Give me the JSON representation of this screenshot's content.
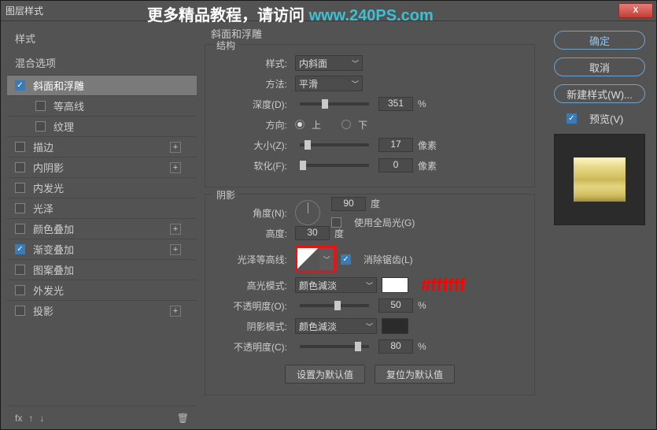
{
  "title": "图层样式",
  "banner": {
    "t1": "更多精品教程，请访问 ",
    "t2": "www.240PS.com"
  },
  "close_x": "X",
  "left": {
    "header": "样式",
    "blend": "混合选项",
    "items": [
      {
        "label": "斜面和浮雕",
        "checked": true,
        "selected": true,
        "plus": false
      },
      {
        "label": "等高线",
        "checked": false,
        "sub": true
      },
      {
        "label": "纹理",
        "checked": false,
        "sub": true
      },
      {
        "label": "描边",
        "checked": false,
        "plus": true
      },
      {
        "label": "内阴影",
        "checked": false,
        "plus": true
      },
      {
        "label": "内发光",
        "checked": false
      },
      {
        "label": "光泽",
        "checked": false
      },
      {
        "label": "颜色叠加",
        "checked": false,
        "plus": true
      },
      {
        "label": "渐变叠加",
        "checked": true,
        "plus": true
      },
      {
        "label": "图案叠加",
        "checked": false
      },
      {
        "label": "外发光",
        "checked": false
      },
      {
        "label": "投影",
        "checked": false,
        "plus": true
      }
    ],
    "footer_fx": "fx"
  },
  "middle": {
    "section": "斜面和浮雕",
    "struct_label": "结构",
    "style_lbl": "样式:",
    "style_val": "内斜面",
    "tech_lbl": "方法:",
    "tech_val": "平滑",
    "depth_lbl": "深度(D):",
    "depth_val": "351",
    "pct": "%",
    "dir_lbl": "方向:",
    "dir_up": "上",
    "dir_down": "下",
    "size_lbl": "大小(Z):",
    "size_val": "17",
    "px": "像素",
    "soften_lbl": "软化(F):",
    "soften_val": "0",
    "shade_label": "阴影",
    "angle_lbl": "角度(N):",
    "angle_val": "90",
    "deg": "度",
    "global_lbl": "使用全局光(G)",
    "alt_lbl": "高度:",
    "alt_val": "30",
    "contour_lbl": "光泽等高线:",
    "aa_lbl": "消除锯齿(L)",
    "hmode_lbl": "高光模式:",
    "hmode_val": "颜色減淡",
    "annot": "#ffffff",
    "hop_lbl": "不透明度(O):",
    "hop_val": "50",
    "smode_lbl": "阴影模式:",
    "smode_val": "颜色減淡",
    "sop_lbl": "不透明度(C):",
    "sop_val": "80",
    "reset_btn": "设置为默认值",
    "restore_btn": "复位为默认值"
  },
  "right": {
    "ok": "确定",
    "cancel": "取消",
    "new": "新建样式(W)...",
    "preview": "预览(V)"
  }
}
